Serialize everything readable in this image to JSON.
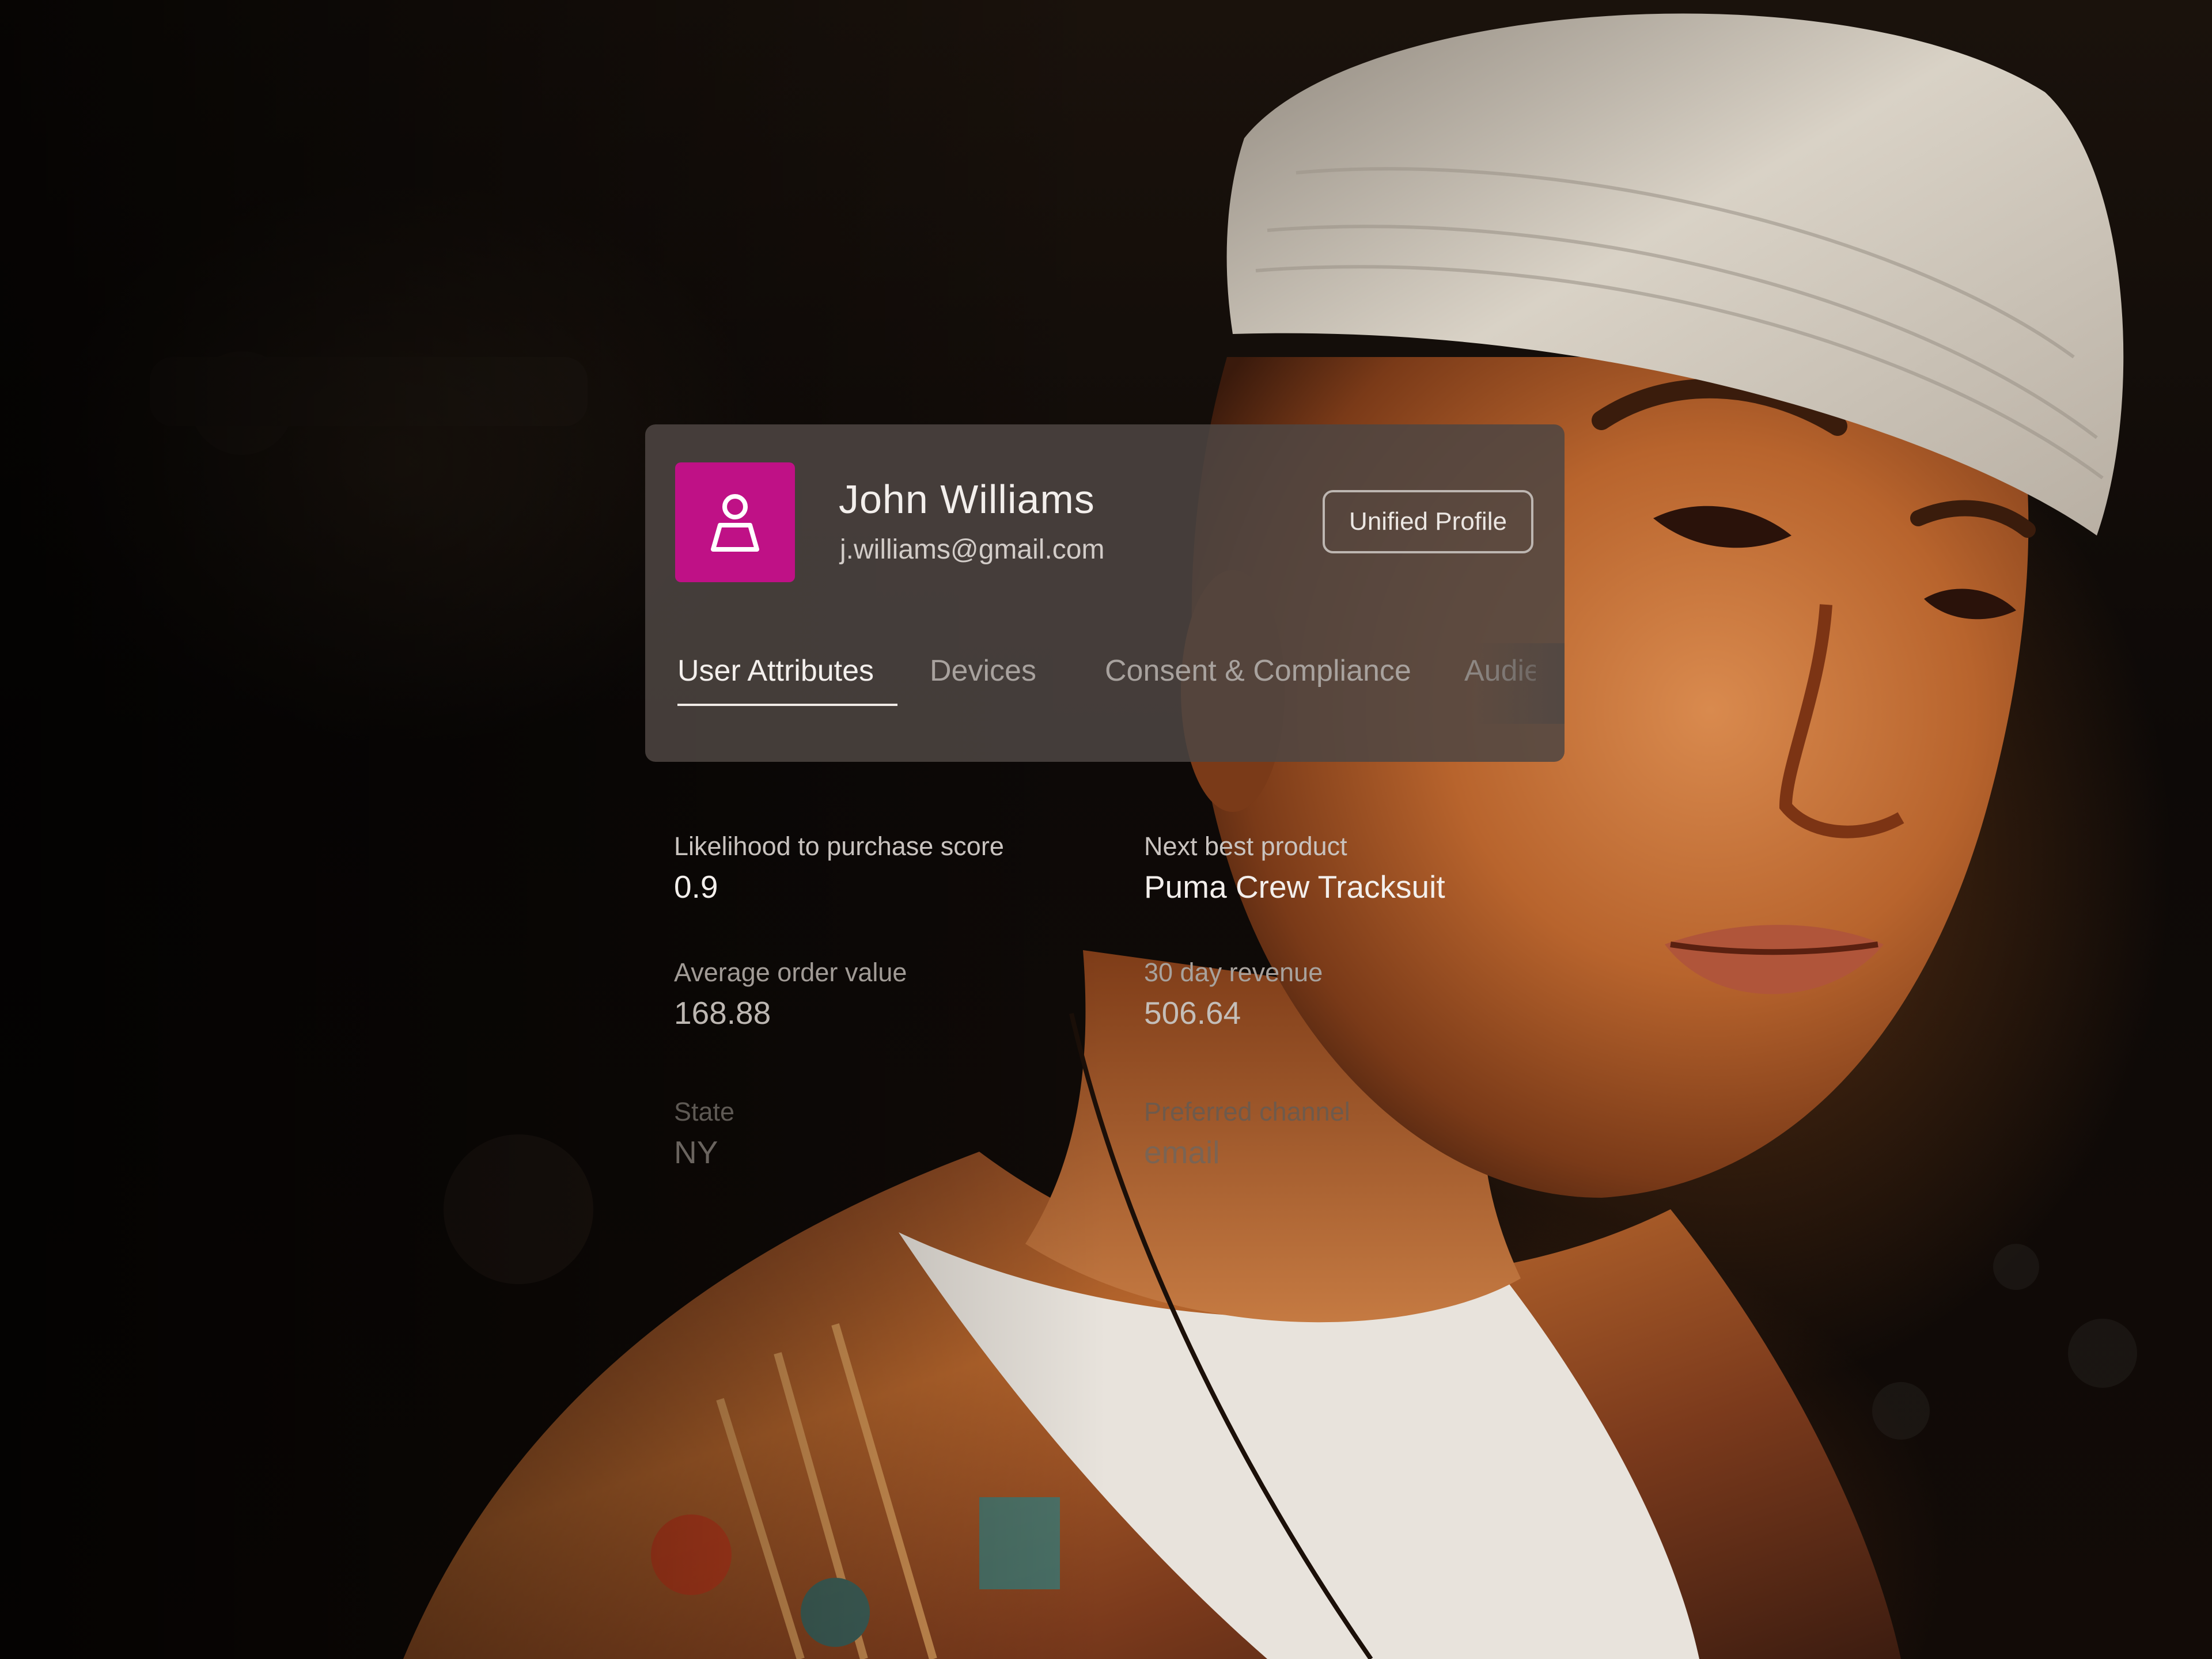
{
  "profile": {
    "name": "John Williams",
    "email": "j.williams@gmail.com",
    "badge": "Unified Profile",
    "avatar_color": "#bf1186",
    "avatar_icon": "user-icon"
  },
  "tabs": [
    {
      "label": "User Attributes",
      "active": true
    },
    {
      "label": "Devices",
      "active": false
    },
    {
      "label": "Consent & Compliance",
      "active": false
    },
    {
      "label": "Audienc",
      "active": false
    }
  ],
  "attributes": [
    {
      "label": "Likelihood to purchase score",
      "value": "0.9"
    },
    {
      "label": "Next best product",
      "value": "Puma Crew Tracksuit"
    },
    {
      "label": "Average order value",
      "value": "168.88"
    },
    {
      "label": "30 day revenue",
      "value": "506.64"
    },
    {
      "label": "State",
      "value": "NY"
    },
    {
      "label": "Preferred channel",
      "value": "email"
    }
  ],
  "colors": {
    "accent": "#bf1186",
    "card": "#4e4642"
  }
}
